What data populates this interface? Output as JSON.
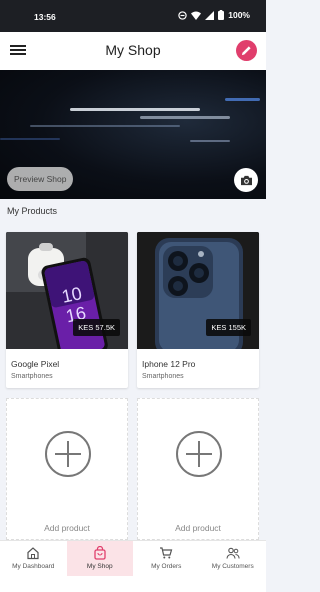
{
  "status": {
    "time": "13:56",
    "battery": "100%"
  },
  "app_bar": {
    "title": "My Shop",
    "menu_icon": "hamburger-menu-icon",
    "edit_icon": "pencil-icon"
  },
  "banner": {
    "preview_label": "Preview Shop",
    "camera_icon": "camera-icon"
  },
  "section": {
    "title": "My Products"
  },
  "products": [
    {
      "name": "Google Pixel",
      "category": "Smartphones",
      "price": "KES 57.5K"
    },
    {
      "name": "Iphone 12 Pro",
      "category": "Smartphones",
      "price": "KES 155K"
    }
  ],
  "add_product": {
    "label": "Add product"
  },
  "nav": [
    {
      "label": "My Dashboard",
      "icon": "home-icon",
      "active": false
    },
    {
      "label": "My Shop",
      "icon": "shopping-bag-icon",
      "active": true
    },
    {
      "label": "My Orders",
      "icon": "cart-icon",
      "active": false
    },
    {
      "label": "My Customers",
      "icon": "people-icon",
      "active": false
    }
  ],
  "colors": {
    "accent": "#e03e6c",
    "active_tab_bg": "#fbe3e7",
    "banner_bg": "#0b0f17"
  },
  "phone_screen_clock": {
    "hour": "10",
    "minute": "16"
  }
}
